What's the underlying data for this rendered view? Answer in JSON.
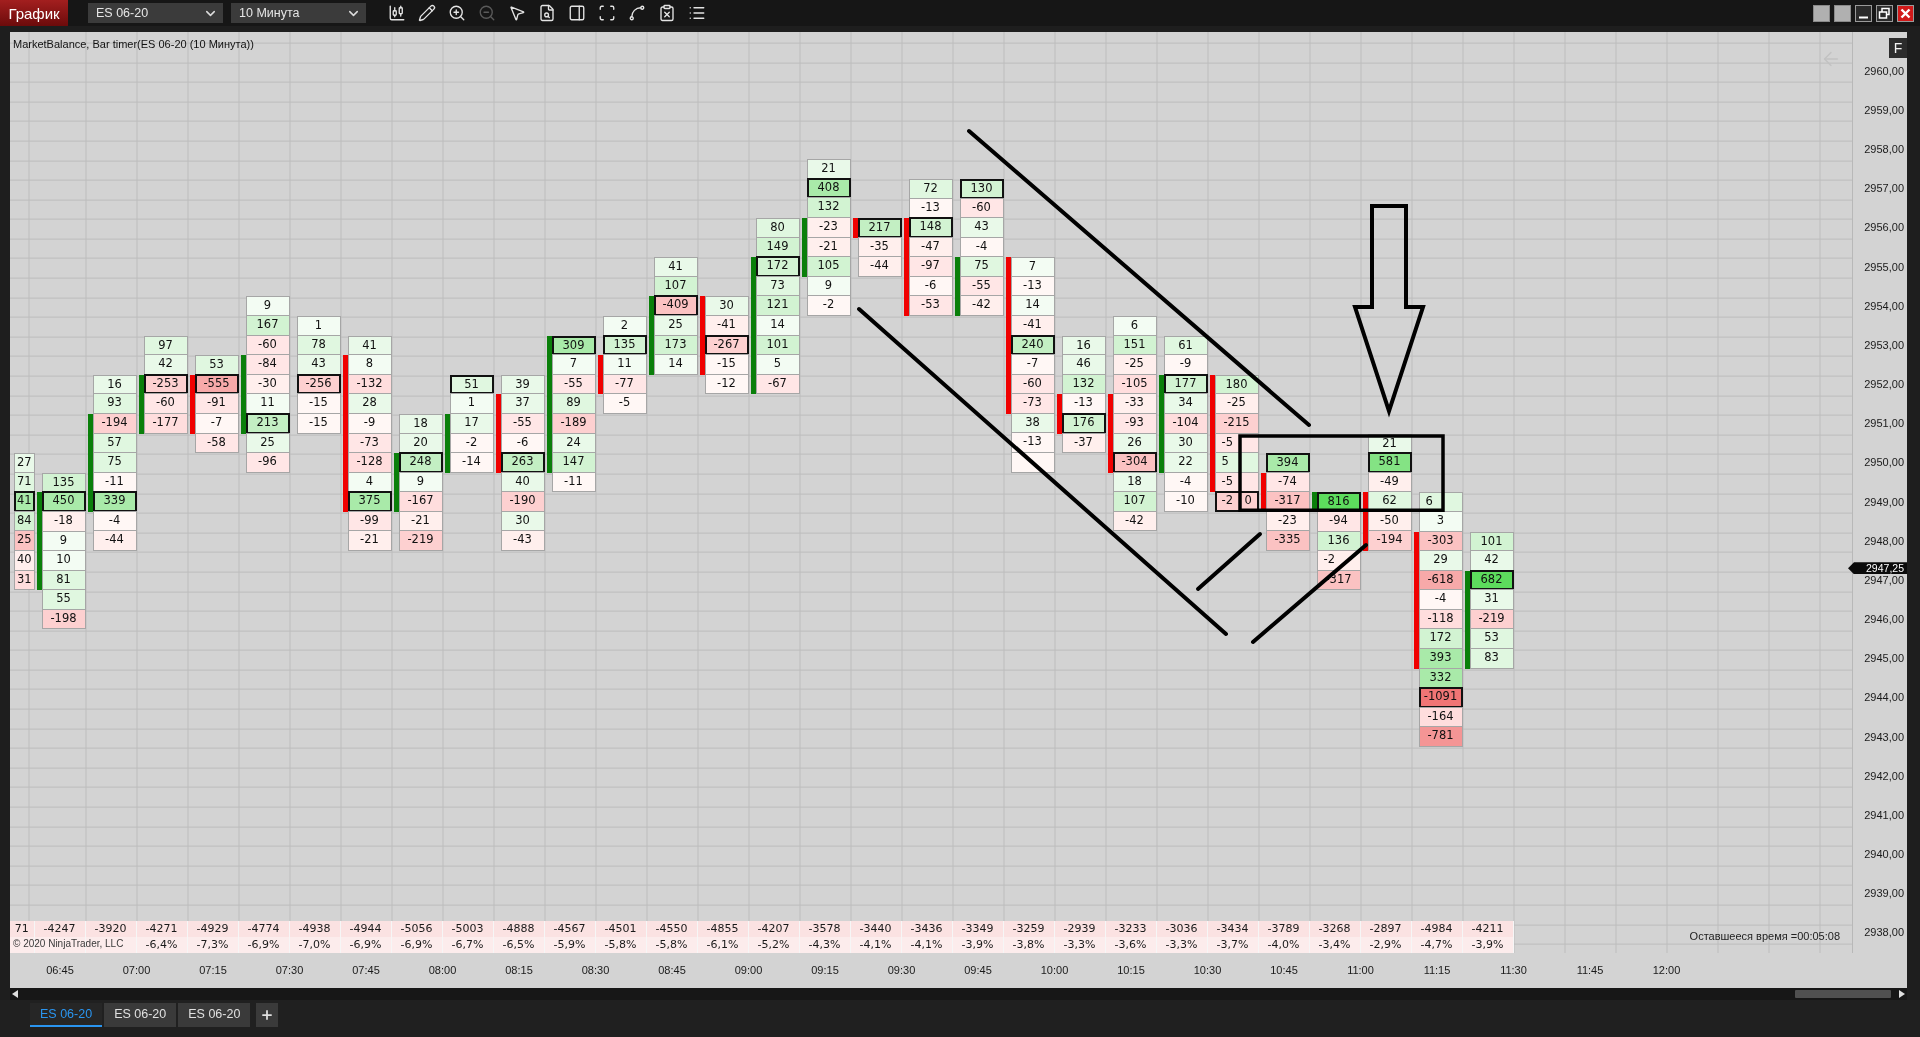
{
  "toolbar": {
    "title": "График",
    "instrument": "ES 06-20",
    "interval": "10 Минута",
    "tools": [
      {
        "kind": "candlestick",
        "disabled": false
      },
      {
        "kind": "pencil",
        "disabled": false
      },
      {
        "kind": "zoom-in",
        "disabled": false
      },
      {
        "kind": "zoom-out",
        "disabled": true
      },
      {
        "kind": "pointer",
        "disabled": false
      },
      {
        "kind": "file-search",
        "disabled": false
      },
      {
        "kind": "panel",
        "disabled": false
      },
      {
        "kind": "scan",
        "disabled": false
      },
      {
        "kind": "spline",
        "disabled": false
      },
      {
        "kind": "clipboard-x",
        "disabled": false
      },
      {
        "kind": "list",
        "disabled": false
      }
    ]
  },
  "chart": {
    "title": "MarketBalance, Bar timer(ES 06-20 (10 Минута))",
    "panel_button": "F",
    "price_axis": [
      "2960,00",
      "2959,00",
      "2958,00",
      "2957,00",
      "2956,00",
      "2955,00",
      "2954,00",
      "2953,00",
      "2952,00",
      "2951,00",
      "2950,00",
      "2949,00",
      "2948,00",
      "2947,00",
      "2946,00",
      "2945,00",
      "2944,00",
      "2943,00",
      "2942,00",
      "2941,00",
      "2940,00",
      "2939,00",
      "2938,00"
    ],
    "current_price": "2947,25",
    "bars": [
      {
        "delta": "71",
        "cells": [
          {
            "value": "27",
            "color": "#e9f9e9",
            "boxed": false
          },
          {
            "value": "71",
            "color": "#e0f7e0",
            "boxed": false
          },
          {
            "value": "41",
            "color": "#a9eaa9",
            "boxed": true
          },
          {
            "value": "84",
            "color": "#d2f3d2",
            "boxed": false
          },
          {
            "value": "25",
            "color": "#fbc2c2",
            "boxed": false
          },
          {
            "value": "40",
            "color": "#ffefed",
            "boxed": false
          },
          {
            "value": "31",
            "color": "#ffdddd",
            "boxed": false
          }
        ]
      },
      {
        "rising": true,
        "delta": "-4247",
        "cells": [
          {
            "value": "135",
            "color": "#d2f3d2",
            "boxed": false
          },
          {
            "value": "450",
            "color": "#a9eaa9",
            "boxed": true
          },
          {
            "value": "-18",
            "color": "#ffefed",
            "boxed": false
          },
          {
            "value": "9",
            "color": "#f3fcf3",
            "boxed": false
          },
          {
            "value": "10",
            "color": "#f3fcf3",
            "boxed": false
          },
          {
            "value": "81",
            "color": "#e0f7e0",
            "boxed": false
          },
          {
            "value": "55",
            "color": "#e0f7e0",
            "boxed": false
          },
          {
            "value": "-198",
            "color": "#fdd0d0",
            "boxed": false
          }
        ]
      },
      {
        "rising": true,
        "delta": "-3920",
        "cells": [
          {
            "value": "16",
            "color": "#e9f9e9",
            "boxed": false
          },
          {
            "value": "93",
            "color": "#e0f7e0",
            "boxed": false
          },
          {
            "value": "-194",
            "color": "#fdd0d0",
            "boxed": false
          },
          {
            "value": "57",
            "color": "#e0f7e0",
            "boxed": false
          },
          {
            "value": "75",
            "color": "#e0f7e0",
            "boxed": false
          },
          {
            "value": "-11",
            "color": "#fff7f5",
            "boxed": false
          },
          {
            "value": "339",
            "color": "#a9eaa9",
            "boxed": true
          },
          {
            "value": "-4",
            "color": "#fff7f5",
            "boxed": false
          },
          {
            "value": "-44",
            "color": "#ffefed",
            "boxed": false
          }
        ]
      },
      {
        "rising": true,
        "delta": "-4271",
        "percent": "-6,4%",
        "cells": [
          {
            "value": "97",
            "color": "#e0f7e0",
            "boxed": false
          },
          {
            "value": "42",
            "color": "#e9f9e9",
            "boxed": false
          },
          {
            "value": "-253",
            "color": "#fdd0d0",
            "boxed": true
          },
          {
            "value": "-60",
            "color": "#ffe6e6",
            "boxed": false
          },
          {
            "value": "-177",
            "color": "#ffdddd",
            "boxed": false
          }
        ]
      },
      {
        "rising": false,
        "delta": "-4929",
        "percent": "-7,3%",
        "cells": [
          {
            "value": "53",
            "color": "#e0f7e0",
            "boxed": false
          },
          {
            "value": "-555",
            "color": "#f7a9a9",
            "boxed": true
          },
          {
            "value": "-91",
            "color": "#ffe6e6",
            "boxed": false
          },
          {
            "value": "-7",
            "color": "#fff7f5",
            "boxed": false
          },
          {
            "value": "-58",
            "color": "#ffe6e6",
            "boxed": false
          }
        ]
      },
      {
        "rising": true,
        "delta": "-4774",
        "percent": "-6,9%",
        "cells": [
          {
            "value": "9",
            "color": "#f3fcf3",
            "boxed": false
          },
          {
            "value": "167",
            "color": "#d2f3d2",
            "boxed": false
          },
          {
            "value": "-60",
            "color": "#ffe6e6",
            "boxed": false
          },
          {
            "value": "-84",
            "color": "#ffe6e6",
            "boxed": false
          },
          {
            "value": "-30",
            "color": "#ffefed",
            "boxed": false
          },
          {
            "value": "11",
            "color": "#f3fcf3",
            "boxed": false
          },
          {
            "value": "213",
            "color": "#c3efc3",
            "boxed": true
          },
          {
            "value": "25",
            "color": "#e9f9e9",
            "boxed": false
          },
          {
            "value": "-96",
            "color": "#ffe6e6",
            "boxed": false
          }
        ]
      },
      {
        "delta": "-4938",
        "percent": "-7,0%",
        "cells": [
          {
            "value": "1",
            "color": "#f3fcf3",
            "boxed": false
          },
          {
            "value": "78",
            "color": "#e0f7e0",
            "boxed": false
          },
          {
            "value": "43",
            "color": "#e9f9e9",
            "boxed": false
          },
          {
            "value": "-256",
            "color": "#fdd0d0",
            "boxed": true
          },
          {
            "value": "-15",
            "color": "#fff7f5",
            "boxed": false
          },
          {
            "value": "-15",
            "color": "#fff7f5",
            "boxed": false
          }
        ]
      },
      {
        "rising": false,
        "delta": "-4944",
        "percent": "-6,9%",
        "cells": [
          {
            "value": "41",
            "color": "#e9f9e9",
            "boxed": false
          },
          {
            "value": "8",
            "color": "#f3fcf3",
            "boxed": false
          },
          {
            "value": "-132",
            "color": "#ffdddd",
            "boxed": false
          },
          {
            "value": "28",
            "color": "#e9f9e9",
            "boxed": false
          },
          {
            "value": "-9",
            "color": "#fff7f5",
            "boxed": false
          },
          {
            "value": "-73",
            "color": "#ffe6e6",
            "boxed": false
          },
          {
            "value": "-128",
            "color": "#ffdddd",
            "boxed": false
          },
          {
            "value": "4",
            "color": "#f3fcf3",
            "boxed": false
          },
          {
            "value": "375",
            "color": "#a9eaa9",
            "boxed": true
          },
          {
            "value": "-99",
            "color": "#ffe6e6",
            "boxed": false
          },
          {
            "value": "-21",
            "color": "#ffefed",
            "boxed": false
          }
        ]
      },
      {
        "rising": true,
        "delta": "-5056",
        "percent": "-6,9%",
        "cells": [
          {
            "value": "18",
            "color": "#e9f9e9",
            "boxed": false
          },
          {
            "value": "20",
            "color": "#e9f9e9",
            "boxed": false
          },
          {
            "value": "248",
            "color": "#c3efc3",
            "boxed": true
          },
          {
            "value": "9",
            "color": "#f3fcf3",
            "boxed": false
          },
          {
            "value": "-167",
            "color": "#ffdddd",
            "boxed": false
          },
          {
            "value": "-21",
            "color": "#ffefed",
            "boxed": false
          },
          {
            "value": "-219",
            "color": "#fdd0d0",
            "boxed": false
          }
        ]
      },
      {
        "rising": true,
        "delta": "-5003",
        "percent": "-6,7%",
        "cells": [
          {
            "value": "51",
            "color": "#e0f7e0",
            "boxed": true
          },
          {
            "value": "1",
            "color": "#f3fcf3",
            "boxed": false
          },
          {
            "value": "17",
            "color": "#e9f9e9",
            "boxed": false
          },
          {
            "value": "-2",
            "color": "#fff7f5",
            "boxed": false
          },
          {
            "value": "-14",
            "color": "#fff7f5",
            "boxed": false
          }
        ]
      },
      {
        "rising": false,
        "delta": "-4888",
        "percent": "-6,5%",
        "cells": [
          {
            "value": "39",
            "color": "#e9f9e9",
            "boxed": false
          },
          {
            "value": "37",
            "color": "#e9f9e9",
            "boxed": false
          },
          {
            "value": "-55",
            "color": "#ffe6e6",
            "boxed": false
          },
          {
            "value": "-6",
            "color": "#fff7f5",
            "boxed": false
          },
          {
            "value": "263",
            "color": "#c3efc3",
            "boxed": true
          },
          {
            "value": "40",
            "color": "#e9f9e9",
            "boxed": false
          },
          {
            "value": "-190",
            "color": "#fdd0d0",
            "boxed": false
          },
          {
            "value": "30",
            "color": "#e9f9e9",
            "boxed": false
          },
          {
            "value": "-43",
            "color": "#ffefed",
            "boxed": false
          }
        ]
      },
      {
        "rising": true,
        "delta": "-4567",
        "percent": "-5,9%",
        "cells": [
          {
            "value": "309",
            "color": "#a9eaa9",
            "boxed": true
          },
          {
            "value": "7",
            "color": "#f3fcf3",
            "boxed": false
          },
          {
            "value": "-55",
            "color": "#ffe6e6",
            "boxed": false
          },
          {
            "value": "89",
            "color": "#e0f7e0",
            "boxed": false
          },
          {
            "value": "-189",
            "color": "#fdd0d0",
            "boxed": false
          },
          {
            "value": "24",
            "color": "#e9f9e9",
            "boxed": false
          },
          {
            "value": "147",
            "color": "#d2f3d2",
            "boxed": false
          },
          {
            "value": "-11",
            "color": "#fff7f5",
            "boxed": false
          }
        ]
      },
      {
        "rising": false,
        "delta": "-4501",
        "percent": "-5,8%",
        "cells": [
          {
            "value": "2",
            "color": "#f3fcf3",
            "boxed": false
          },
          {
            "value": "135",
            "color": "#d2f3d2",
            "boxed": true
          },
          {
            "value": "11",
            "color": "#f3fcf3",
            "boxed": false
          },
          {
            "value": "-77",
            "color": "#ffe6e6",
            "boxed": false
          },
          {
            "value": "-5",
            "color": "#fff7f5",
            "boxed": false
          }
        ]
      },
      {
        "rising": true,
        "delta": "-4550",
        "percent": "-5,8%",
        "cells": [
          {
            "value": "41",
            "color": "#e9f9e9",
            "boxed": false
          },
          {
            "value": "107",
            "color": "#d2f3d2",
            "boxed": false
          },
          {
            "value": "-409",
            "color": "#fbc2c2",
            "boxed": true
          },
          {
            "value": "25",
            "color": "#e9f9e9",
            "boxed": false
          },
          {
            "value": "173",
            "color": "#d2f3d2",
            "boxed": false
          },
          {
            "value": "14",
            "color": "#f3fcf3",
            "boxed": false
          }
        ]
      },
      {
        "rising": false,
        "delta": "-4855",
        "percent": "-6,1%",
        "cells": [
          {
            "value": "30",
            "color": "#e9f9e9",
            "boxed": false
          },
          {
            "value": "-41",
            "color": "#ffefed",
            "boxed": false
          },
          {
            "value": "-267",
            "color": "#fdd0d0",
            "boxed": true
          },
          {
            "value": "-15",
            "color": "#fff7f5",
            "boxed": false
          },
          {
            "value": "-12",
            "color": "#fff7f5",
            "boxed": false
          }
        ]
      },
      {
        "rising": true,
        "delta": "-4207",
        "percent": "-5,2%",
        "cells": [
          {
            "value": "80",
            "color": "#e0f7e0",
            "boxed": false
          },
          {
            "value": "149",
            "color": "#d2f3d2",
            "boxed": false
          },
          {
            "value": "172",
            "color": "#d2f3d2",
            "boxed": true
          },
          {
            "value": "73",
            "color": "#e0f7e0",
            "boxed": false
          },
          {
            "value": "121",
            "color": "#d2f3d2",
            "boxed": false
          },
          {
            "value": "14",
            "color": "#f3fcf3",
            "boxed": false
          },
          {
            "value": "101",
            "color": "#d2f3d2",
            "boxed": false
          },
          {
            "value": "5",
            "color": "#f3fcf3",
            "boxed": false
          },
          {
            "value": "-67",
            "color": "#ffe6e6",
            "boxed": false
          }
        ]
      },
      {
        "rising": true,
        "delta": "-3578",
        "percent": "-4,3%",
        "cells": [
          {
            "value": "21",
            "color": "#e9f9e9",
            "boxed": false
          },
          {
            "value": "408",
            "color": "#a9eaa9",
            "boxed": true
          },
          {
            "value": "132",
            "color": "#d2f3d2",
            "boxed": false
          },
          {
            "value": "-23",
            "color": "#ffefed",
            "boxed": false
          },
          {
            "value": "-21",
            "color": "#ffefed",
            "boxed": false
          },
          {
            "value": "105",
            "color": "#d2f3d2",
            "boxed": false
          },
          {
            "value": "9",
            "color": "#f3fcf3",
            "boxed": false
          },
          {
            "value": "-2",
            "color": "#fff7f5",
            "boxed": false
          }
        ]
      },
      {
        "rising": false,
        "delta": "-3440",
        "percent": "-4,1%",
        "cells": [
          {
            "value": "217",
            "color": "#c3efc3",
            "boxed": true
          },
          {
            "value": "-35",
            "color": "#ffefed",
            "boxed": false
          },
          {
            "value": "-44",
            "color": "#ffefed",
            "boxed": false
          }
        ]
      },
      {
        "rising": false,
        "delta": "-3436",
        "percent": "-4,1%",
        "cells": [
          {
            "value": "72",
            "color": "#e0f7e0",
            "boxed": false
          },
          {
            "value": "-13",
            "color": "#fff7f5",
            "boxed": false
          },
          {
            "value": "148",
            "color": "#d2f3d2",
            "boxed": true
          },
          {
            "value": "-47",
            "color": "#ffefed",
            "boxed": false
          },
          {
            "value": "-97",
            "color": "#ffe6e6",
            "boxed": false
          },
          {
            "value": "-6",
            "color": "#fff7f5",
            "boxed": false
          },
          {
            "value": "-53",
            "color": "#ffe6e6",
            "boxed": false
          }
        ]
      },
      {
        "rising": true,
        "delta": "-3349",
        "percent": "-3,9%",
        "cells": [
          {
            "value": "130",
            "color": "#d2f3d2",
            "boxed": true
          },
          {
            "value": "-60",
            "color": "#ffe6e6",
            "boxed": false
          },
          {
            "value": "43",
            "color": "#e9f9e9",
            "boxed": false
          },
          {
            "value": "-4",
            "color": "#fff7f5",
            "boxed": false
          },
          {
            "value": "75",
            "color": "#e0f7e0",
            "boxed": false
          },
          {
            "value": "-55",
            "color": "#ffe6e6",
            "boxed": false
          },
          {
            "value": "-42",
            "color": "#ffefed",
            "boxed": false
          }
        ]
      },
      {
        "rising": false,
        "delta": "-3259",
        "percent": "-3,8%",
        "cells": [
          {
            "value": "7",
            "color": "#f3fcf3",
            "boxed": false
          },
          {
            "value": "-13",
            "color": "#fff7f5",
            "boxed": false
          },
          {
            "value": "14",
            "color": "#f3fcf3",
            "boxed": false
          },
          {
            "value": "-41",
            "color": "#ffefed",
            "boxed": false
          },
          {
            "value": "240",
            "color": "#c3efc3",
            "boxed": true
          },
          {
            "value": "-7",
            "color": "#fff7f5",
            "boxed": false
          },
          {
            "value": "-60",
            "color": "#ffe6e6",
            "boxed": false
          },
          {
            "value": "-73",
            "color": "#ffe6e6",
            "boxed": false
          },
          {
            "value": "38",
            "color": "#e9f9e9",
            "boxed": false
          },
          {
            "value": "-13",
            "color": "#fff7f5",
            "boxed": false
          },
          {
            "color": "#fff7f5",
            "boxed": false
          }
        ]
      },
      {
        "rising": false,
        "delta": "-2939",
        "percent": "-3,3%",
        "cells": [
          {
            "value": "16",
            "color": "#e9f9e9",
            "boxed": false
          },
          {
            "value": "46",
            "color": "#e9f9e9",
            "boxed": false
          },
          {
            "value": "132",
            "color": "#d2f3d2",
            "boxed": false
          },
          {
            "value": "-13",
            "color": "#fff7f5",
            "boxed": false
          },
          {
            "value": "176",
            "color": "#d2f3d2",
            "boxed": true
          },
          {
            "value": "-37",
            "color": "#ffefed",
            "boxed": false
          }
        ]
      },
      {
        "rising": false,
        "delta": "-3233",
        "percent": "-3,6%",
        "cells": [
          {
            "value": "6",
            "color": "#f3fcf3",
            "boxed": false
          },
          {
            "value": "151",
            "color": "#d2f3d2",
            "boxed": false
          },
          {
            "value": "-25",
            "color": "#ffefed",
            "boxed": false
          },
          {
            "value": "-105",
            "color": "#ffdddd",
            "boxed": false
          },
          {
            "value": "-33",
            "color": "#ffefed",
            "boxed": false
          },
          {
            "value": "-93",
            "color": "#ffe6e6",
            "boxed": false
          },
          {
            "value": "26",
            "color": "#e9f9e9",
            "boxed": false
          },
          {
            "value": "-304",
            "color": "#fbc2c2",
            "boxed": true
          },
          {
            "value": "18",
            "color": "#e9f9e9",
            "boxed": false
          },
          {
            "value": "107",
            "color": "#d2f3d2",
            "boxed": false
          },
          {
            "value": "-42",
            "color": "#ffefed",
            "boxed": false
          }
        ]
      },
      {
        "rising": true,
        "delta": "-3036",
        "percent": "-3,3%",
        "cells": [
          {
            "value": "61",
            "color": "#e0f7e0",
            "boxed": false
          },
          {
            "value": "-9",
            "color": "#fff7f5",
            "boxed": false
          },
          {
            "value": "177",
            "color": "#d2f3d2",
            "boxed": true
          },
          {
            "value": "34",
            "color": "#e9f9e9",
            "boxed": false
          },
          {
            "value": "-104",
            "color": "#ffdddd",
            "boxed": false
          },
          {
            "value": "30",
            "color": "#e9f9e9",
            "boxed": false
          },
          {
            "value": "22",
            "color": "#e9f9e9",
            "boxed": false
          },
          {
            "value": "-4",
            "color": "#fff7f5",
            "boxed": false
          },
          {
            "value": "-10",
            "color": "#fff7f5",
            "boxed": false
          }
        ]
      },
      {
        "rising": false,
        "delta": "-3434",
        "percent": "-3,7%",
        "cells": [
          {
            "value": "180",
            "color": "#d2f3d2",
            "boxed": false
          },
          {
            "value": "-25",
            "color": "#ffefed",
            "boxed": false
          },
          {
            "value": "-215",
            "color": "#fdd0d0",
            "boxed": false
          },
          {
            "value": "-5",
            "color": "#ffe6e6",
            "boxed": false
          },
          {
            "value": "5",
            "color": "#e0f7e0",
            "boxed": false
          },
          {
            "value": "-5",
            "color": "#ffe6e6",
            "boxed": false
          },
          {
            "value": "-2 0",
            "color": "#fdd0d0",
            "boxed": true
          }
        ]
      },
      {
        "rising": false,
        "delta": "-3789",
        "percent": "-4,0%",
        "cells": [
          {
            "value": "394",
            "color": "#a9eaa9",
            "boxed": true
          },
          {
            "value": "-74",
            "color": "#ffe6e6",
            "boxed": false
          },
          {
            "value": "-317",
            "color": "#fbc2c2",
            "boxed": false
          },
          {
            "value": "-23",
            "color": "#ffefed",
            "boxed": false
          },
          {
            "value": "-335",
            "color": "#fbc2c2",
            "boxed": false
          }
        ]
      },
      {
        "rising": true,
        "delta": "-3268",
        "percent": "-3,4%",
        "cells": [
          {
            "value": "816",
            "color": "#5ddc5d",
            "boxed": true
          },
          {
            "value": "-94",
            "color": "#ffe6e6",
            "boxed": false
          },
          {
            "value": "136",
            "color": "#d2f3d2",
            "boxed": false
          },
          {
            "value": "-2",
            "color": "#ffefed",
            "boxed": false
          },
          {
            "value": "-317",
            "color": "#fbc2c2",
            "boxed": false
          }
        ]
      },
      {
        "rising": false,
        "delta": "-2897",
        "percent": "-2,9%",
        "cells": [
          {
            "value": "21",
            "color": "#e9f9e9",
            "boxed": false
          },
          {
            "value": "581",
            "color": "#84e384",
            "boxed": true
          },
          {
            "value": "-49",
            "color": "#ffefed",
            "boxed": false
          },
          {
            "value": "62",
            "color": "#e0f7e0",
            "boxed": false
          },
          {
            "value": "-50",
            "color": "#ffefed",
            "boxed": false
          },
          {
            "value": "-194",
            "color": "#fdd0d0",
            "boxed": false
          }
        ]
      },
      {
        "rising": false,
        "delta": "-4984",
        "percent": "-4,7%",
        "cells": [
          {
            "value": "6",
            "color": "#e0f7e0",
            "boxed": false
          },
          {
            "value": "3",
            "color": "#f3fcf3",
            "boxed": false
          },
          {
            "value": "-303",
            "color": "#fbc2c2",
            "boxed": false
          },
          {
            "value": "29",
            "color": "#e9f9e9",
            "boxed": false
          },
          {
            "value": "-618",
            "color": "#f7a9a9",
            "boxed": false
          },
          {
            "value": "-4",
            "color": "#fff7f5",
            "boxed": false
          },
          {
            "value": "-118",
            "color": "#ffdddd",
            "boxed": false
          },
          {
            "value": "172",
            "color": "#d2f3d2",
            "boxed": false
          },
          {
            "value": "393",
            "color": "#a9eaa9",
            "boxed": false
          },
          {
            "value": "332",
            "color": "#a9eaa9",
            "boxed": false
          },
          {
            "value": "-1091",
            "color": "#f07575",
            "boxed": true
          },
          {
            "value": "-164",
            "color": "#ffdddd",
            "boxed": false
          },
          {
            "value": "-781",
            "color": "#f49595",
            "boxed": false
          }
        ]
      },
      {
        "rising": true,
        "delta": "-4211",
        "percent": "-3,9%",
        "cells": [
          {
            "value": "101",
            "color": "#d2f3d2",
            "boxed": false
          },
          {
            "value": "42",
            "color": "#e9f9e9",
            "boxed": false
          },
          {
            "value": "682",
            "color": "#5ddc5d",
            "boxed": true
          },
          {
            "value": "31",
            "color": "#e9f9e9",
            "boxed": false
          },
          {
            "value": "-219",
            "color": "#fdd0d0",
            "boxed": false
          },
          {
            "value": "53",
            "color": "#e0f7e0",
            "boxed": false
          },
          {
            "value": "83",
            "color": "#e0f7e0",
            "boxed": false
          }
        ]
      }
    ],
    "timer_text": "Оставшееся время =00:05:08",
    "copyright": "© 2020 NinjaTrader, LLC",
    "time_axis": [
      "06:45",
      "07:00",
      "07:15",
      "07:30",
      "07:45",
      "08:00",
      "08:15",
      "08:30",
      "08:45",
      "09:00",
      "09:15",
      "09:30",
      "09:45",
      "10:00",
      "10:15",
      "10:30",
      "10:45",
      "11:00",
      "11:15",
      "11:30",
      "11:45",
      "12:00"
    ]
  },
  "tabs": [
    {
      "label": "ES 06-20",
      "selected": true
    },
    {
      "label": "ES 06-20",
      "selected": false
    },
    {
      "label": "ES 06-20",
      "selected": false
    }
  ]
}
